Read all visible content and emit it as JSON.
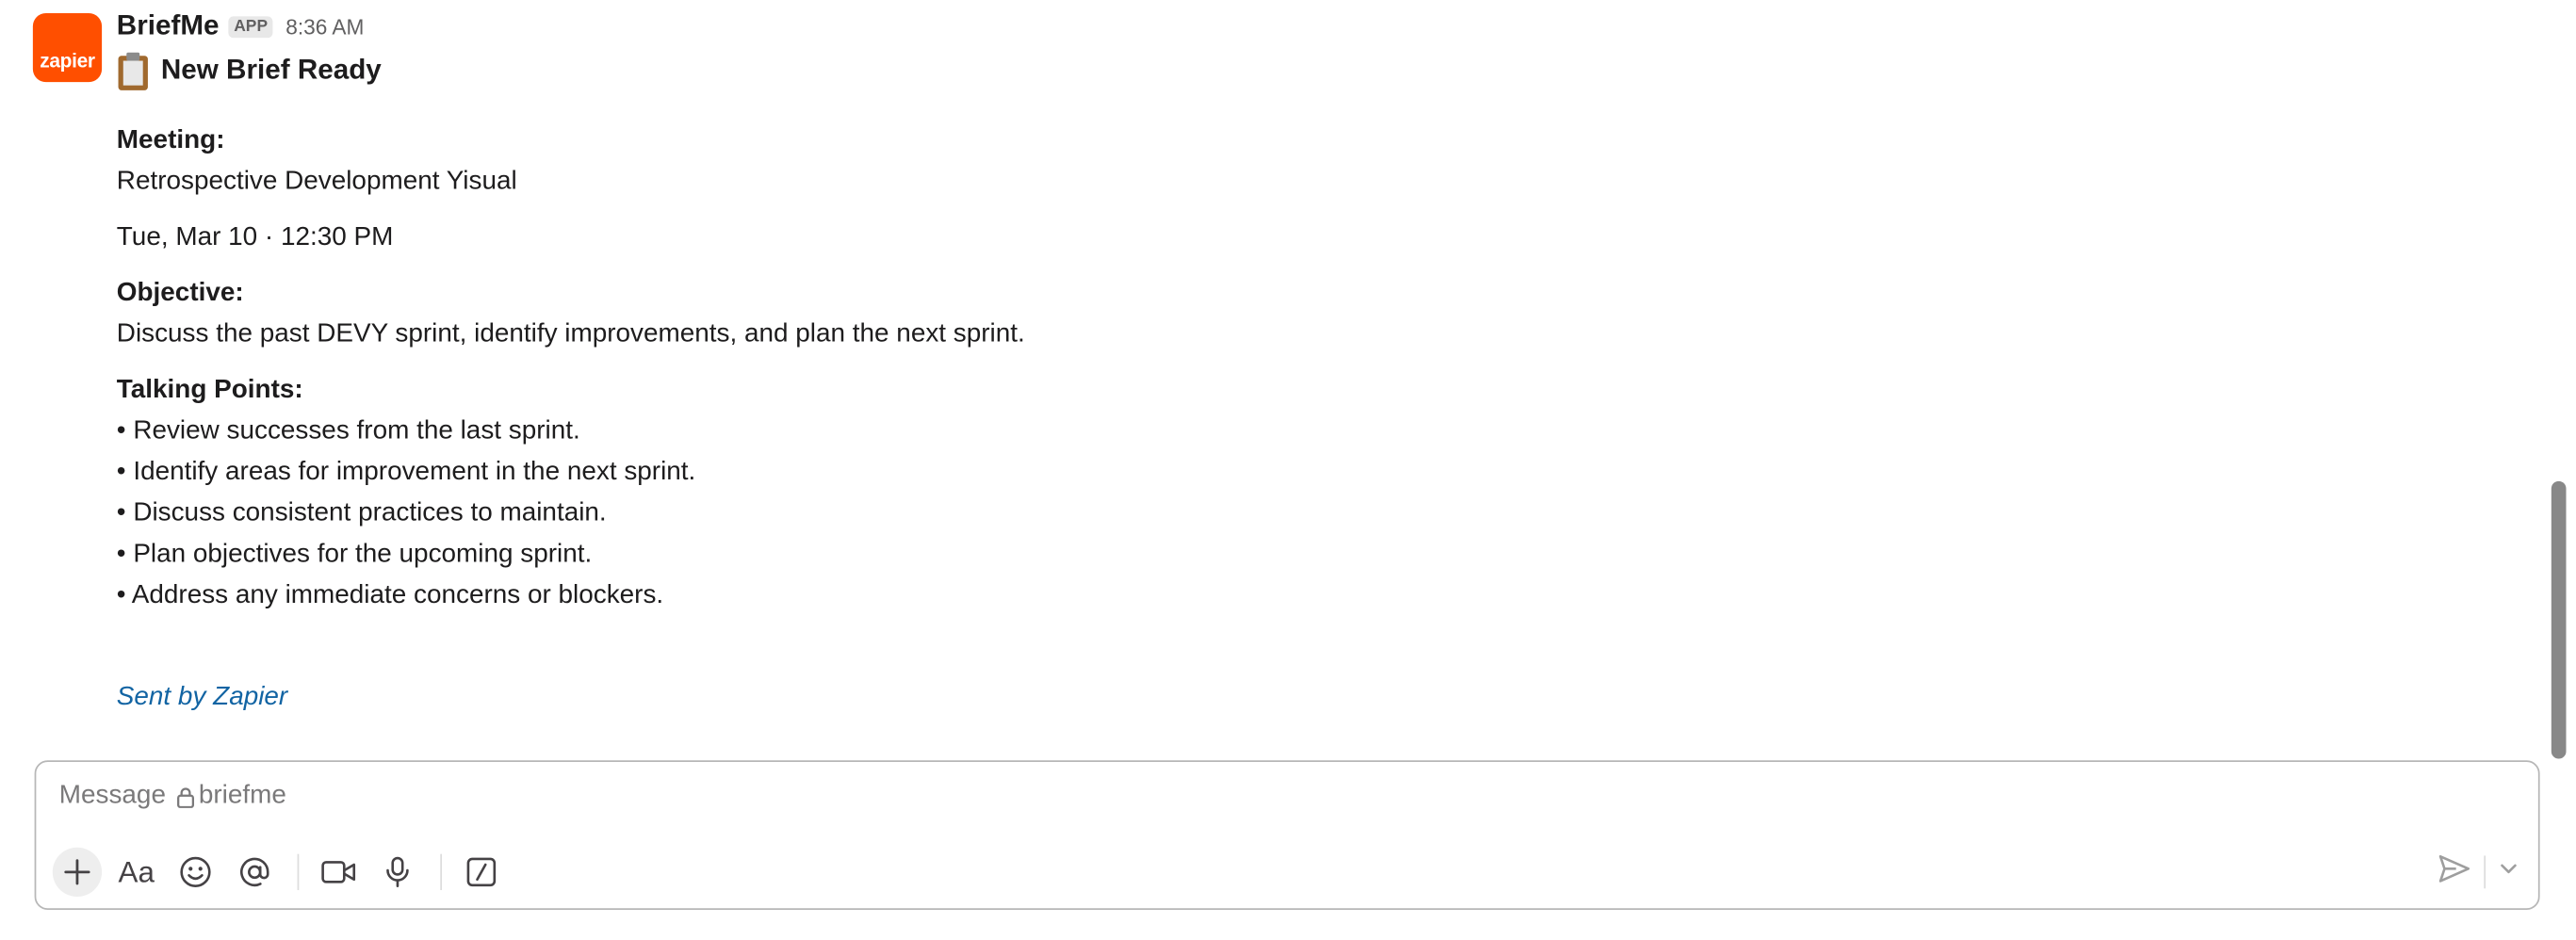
{
  "message": {
    "avatar_text": "zapier",
    "sender": "BriefMe",
    "badge": "APP",
    "time": "8:36 AM",
    "title": "New Brief Ready",
    "title_icon": "clipboard-icon",
    "meeting_label": "Meeting:",
    "meeting_name": "Retrospective Development Yisual",
    "meeting_datetime": "Tue, Mar 10 · 12:30 PM",
    "objective_label": "Objective:",
    "objective": "Discuss the past DEVY sprint, identify improvements, and plan the next sprint.",
    "talking_points_label": "Talking Points:",
    "talking_points": [
      "• Review successes from the last sprint.",
      "• Identify areas for improvement in the next sprint.",
      "• Discuss consistent practices to maintain.",
      "• Plan objectives for the upcoming sprint.",
      "• Address any immediate concerns or blockers."
    ],
    "sent_by": "Sent by Zapier"
  },
  "composer": {
    "placeholder_prefix": "Message",
    "channel": "briefme",
    "tools": [
      "plus-icon",
      "text-format-icon",
      "emoji-icon",
      "mention-icon",
      "video-icon",
      "microphone-icon",
      "slash-command-icon"
    ],
    "format_label": "Aa"
  },
  "colors": {
    "avatar": "#ff4f00",
    "link": "#1264a3",
    "text": "#1d1c1d",
    "muted": "#616061"
  }
}
